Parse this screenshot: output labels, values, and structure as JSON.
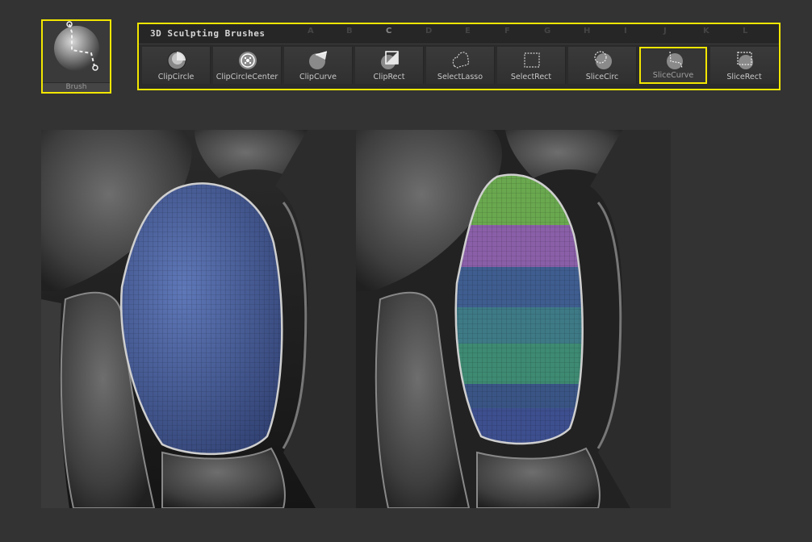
{
  "brush_thumbnail": {
    "label": "Brush",
    "icon": "slice-curve-sphere-icon"
  },
  "palette": {
    "title": "3D Sculpting Brushes",
    "hotkeys": [
      "A",
      "B",
      "C",
      "D",
      "E",
      "F",
      "G",
      "H",
      "I",
      "J",
      "K",
      "L"
    ],
    "active_hotkey": "C",
    "brushes": [
      {
        "label": "ClipCircle",
        "icon": "clip-circle-icon"
      },
      {
        "label": "ClipCircleCenter",
        "icon": "clip-circle-center-icon"
      },
      {
        "label": "ClipCurve",
        "icon": "clip-curve-icon"
      },
      {
        "label": "ClipRect",
        "icon": "clip-rect-icon"
      },
      {
        "label": "SelectLasso",
        "icon": "select-lasso-icon"
      },
      {
        "label": "SelectRect",
        "icon": "select-rect-icon"
      },
      {
        "label": "SliceCirc",
        "icon": "slice-circ-icon"
      },
      {
        "label": "SliceCurve",
        "icon": "slice-curve-icon"
      },
      {
        "label": "SliceRect",
        "icon": "slice-rect-icon"
      }
    ],
    "selected_brush": "SliceCurve"
  },
  "colors": {
    "highlight": "#f2e600",
    "panel_before": "#4a5f9a",
    "polygroups_after": [
      "#6aa84f",
      "#8a5fa8",
      "#3f5d8f",
      "#3e7a86",
      "#3e8a72",
      "#3a5585",
      "#3d4f8e"
    ]
  }
}
